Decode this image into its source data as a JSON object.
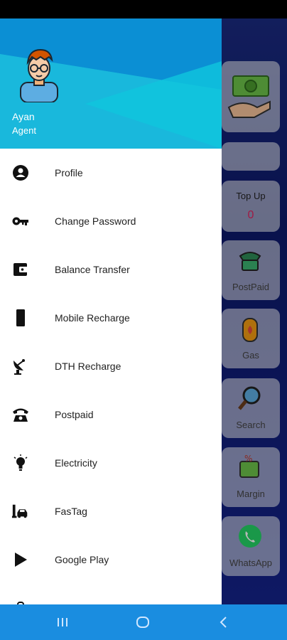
{
  "user": {
    "name": "Ayan",
    "role": "Agent"
  },
  "menu": [
    {
      "label": "Profile",
      "icon": "account-circle-icon"
    },
    {
      "label": "Change Password",
      "icon": "key-icon"
    },
    {
      "label": "Balance Transfer",
      "icon": "wallet-icon"
    },
    {
      "label": "Mobile Recharge",
      "icon": "mobile-phone-icon"
    },
    {
      "label": "DTH Recharge",
      "icon": "satellite-dish-icon"
    },
    {
      "label": "Postpaid",
      "icon": "telephone-icon"
    },
    {
      "label": "Electricity",
      "icon": "lightbulb-icon"
    },
    {
      "label": "FasTag",
      "icon": "fastag-car-icon"
    },
    {
      "label": "Google Play",
      "icon": "play-icon"
    }
  ],
  "background": {
    "topup": {
      "label": "Top Up",
      "value": "0"
    },
    "tiles": [
      {
        "label": "PostPaid"
      },
      {
        "label": "Gas"
      },
      {
        "label": "Search"
      },
      {
        "label": "Margin"
      },
      {
        "label": "WhatsApp"
      }
    ]
  },
  "colors": {
    "header_accent": "#0aa6d6",
    "nav_bar": "#1a8de0",
    "topup_value": "#e0245e"
  }
}
